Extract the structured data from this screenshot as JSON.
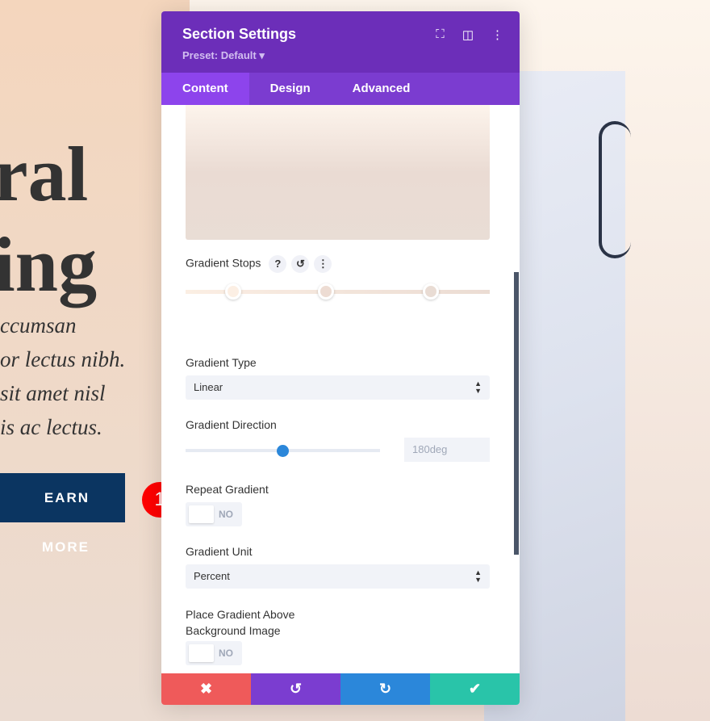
{
  "hero": {
    "heading_line1": "ral",
    "heading_line2": "ing",
    "paragraph": [
      "ccumsan",
      "or lectus nibh.",
      "sit amet nisl",
      "is ac lectus."
    ],
    "button": "EARN MORE"
  },
  "annotation_badge": "1",
  "panel": {
    "title": "Section Settings",
    "preset": "Preset: Default ▾",
    "tabs": [
      {
        "label": "Content"
      },
      {
        "label": "Design"
      },
      {
        "label": "Advanced"
      }
    ],
    "gradient_stops_label": "Gradient Stops",
    "gradient_stop_colors": [
      "#fcefe4",
      "#eddcd3",
      "#e9dcd4"
    ],
    "gradient_type_label": "Gradient Type",
    "gradient_type_value": "Linear",
    "gradient_direction_label": "Gradient Direction",
    "gradient_direction_value": "180deg",
    "repeat_gradient_label": "Repeat Gradient",
    "repeat_gradient_value": "NO",
    "gradient_unit_label": "Gradient Unit",
    "gradient_unit_value": "Percent",
    "place_above_label_1": "Place Gradient Above",
    "place_above_label_2": "Background Image",
    "place_above_value": "NO",
    "footer_colors": {
      "cancel": "#ef5a5a",
      "undo": "#7b3dd0",
      "redo": "#2b87da",
      "save": "#29c4a9"
    }
  }
}
